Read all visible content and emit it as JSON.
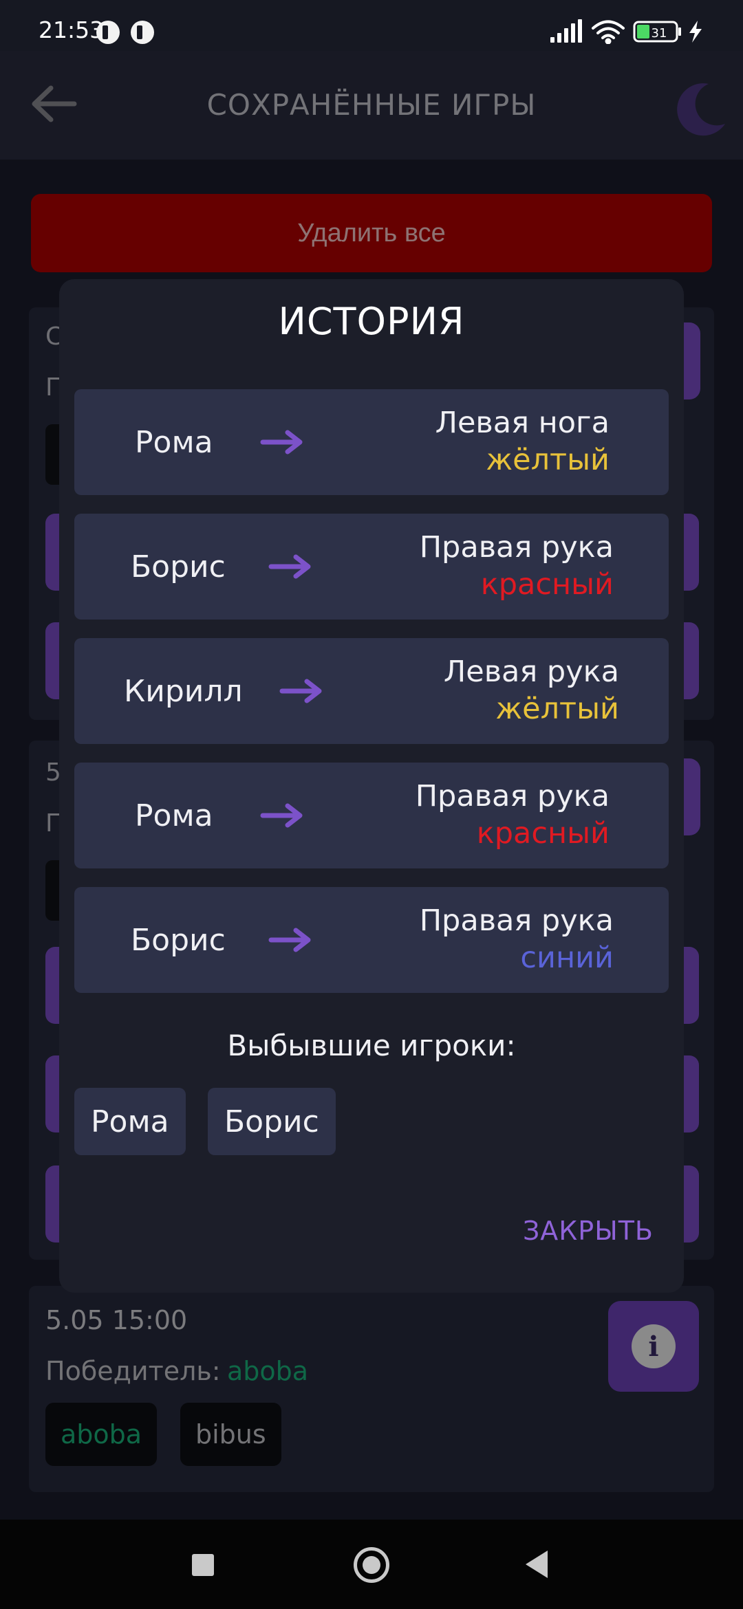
{
  "status_bar": {
    "time": "21:53",
    "battery": "31"
  },
  "app_bar": {
    "title": "СОХРАНЁННЫЕ ИГРЫ"
  },
  "content": {
    "delete_all_label": "Удалить все",
    "peek_texts": [
      "С",
      "П",
      "5",
      "П"
    ],
    "last_card": {
      "date": "5.05 15:00",
      "winner_label": "Победитель:",
      "winner_name": "aboba",
      "players": [
        "aboba",
        "bibus"
      ]
    }
  },
  "dialog": {
    "title": "ИСТОРИЯ",
    "history": [
      {
        "player": "Рома",
        "limb": "Левая нога",
        "color": "жёлтый",
        "color_hex": "#e8c23a"
      },
      {
        "player": "Борис",
        "limb": "Правая рука",
        "color": "красный",
        "color_hex": "#e01a22"
      },
      {
        "player": "Кирилл",
        "limb": "Левая рука",
        "color": "жёлтый",
        "color_hex": "#e8c23a"
      },
      {
        "player": "Рома",
        "limb": "Правая рука",
        "color": "красный",
        "color_hex": "#e01a22"
      },
      {
        "player": "Борис",
        "limb": "Правая рука",
        "color": "синий",
        "color_hex": "#5a63d8"
      }
    ],
    "eliminated_label": "Выбывшие игроки:",
    "eliminated": [
      "Рома",
      "Борис"
    ],
    "close_label": "ЗАКРЫТЬ"
  },
  "colors": {
    "accent": "#7c52c9",
    "danger": "#b00000",
    "winner": "#1ab37a"
  },
  "icons": [
    "back-arrow-icon",
    "moon-icon",
    "arrow-right-icon",
    "info-icon",
    "signal-icon",
    "wifi-icon",
    "battery-icon",
    "charging-icon"
  ]
}
